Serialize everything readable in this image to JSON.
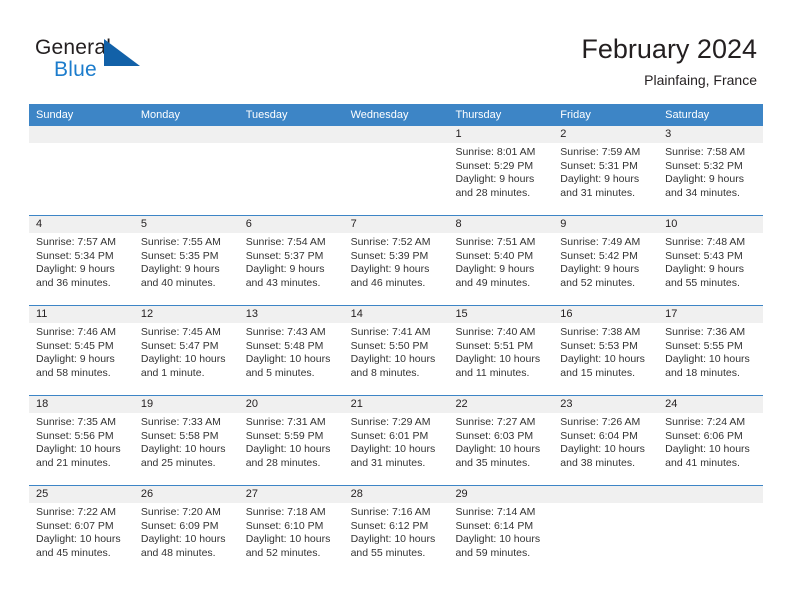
{
  "brand": {
    "name_part1": "General",
    "name_part2": "Blue",
    "logo_icon": "blue-triangle-logo",
    "color_blue": "#1c7ccc",
    "color_dark": "#231f20"
  },
  "header": {
    "title": "February 2024",
    "location": "Plainfaing, France"
  },
  "theme": {
    "header_row_bg": "#3d85c6",
    "date_band_bg": "#f0f0f0",
    "cell_bg": "#ffffff",
    "text": "#231f20"
  },
  "weekdays": [
    "Sunday",
    "Monday",
    "Tuesday",
    "Wednesday",
    "Thursday",
    "Friday",
    "Saturday"
  ],
  "weeks": [
    {
      "dates": [
        "",
        "",
        "",
        "",
        "1",
        "2",
        "3"
      ],
      "cells": [
        {
          "lines": []
        },
        {
          "lines": []
        },
        {
          "lines": []
        },
        {
          "lines": []
        },
        {
          "lines": [
            "Sunrise: 8:01 AM",
            "Sunset: 5:29 PM",
            "Daylight: 9 hours",
            "and 28 minutes."
          ]
        },
        {
          "lines": [
            "Sunrise: 7:59 AM",
            "Sunset: 5:31 PM",
            "Daylight: 9 hours",
            "and 31 minutes."
          ]
        },
        {
          "lines": [
            "Sunrise: 7:58 AM",
            "Sunset: 5:32 PM",
            "Daylight: 9 hours",
            "and 34 minutes."
          ]
        }
      ]
    },
    {
      "dates": [
        "4",
        "5",
        "6",
        "7",
        "8",
        "9",
        "10"
      ],
      "cells": [
        {
          "lines": [
            "Sunrise: 7:57 AM",
            "Sunset: 5:34 PM",
            "Daylight: 9 hours",
            "and 36 minutes."
          ]
        },
        {
          "lines": [
            "Sunrise: 7:55 AM",
            "Sunset: 5:35 PM",
            "Daylight: 9 hours",
            "and 40 minutes."
          ]
        },
        {
          "lines": [
            "Sunrise: 7:54 AM",
            "Sunset: 5:37 PM",
            "Daylight: 9 hours",
            "and 43 minutes."
          ]
        },
        {
          "lines": [
            "Sunrise: 7:52 AM",
            "Sunset: 5:39 PM",
            "Daylight: 9 hours",
            "and 46 minutes."
          ]
        },
        {
          "lines": [
            "Sunrise: 7:51 AM",
            "Sunset: 5:40 PM",
            "Daylight: 9 hours",
            "and 49 minutes."
          ]
        },
        {
          "lines": [
            "Sunrise: 7:49 AM",
            "Sunset: 5:42 PM",
            "Daylight: 9 hours",
            "and 52 minutes."
          ]
        },
        {
          "lines": [
            "Sunrise: 7:48 AM",
            "Sunset: 5:43 PM",
            "Daylight: 9 hours",
            "and 55 minutes."
          ]
        }
      ]
    },
    {
      "dates": [
        "11",
        "12",
        "13",
        "14",
        "15",
        "16",
        "17"
      ],
      "cells": [
        {
          "lines": [
            "Sunrise: 7:46 AM",
            "Sunset: 5:45 PM",
            "Daylight: 9 hours",
            "and 58 minutes."
          ]
        },
        {
          "lines": [
            "Sunrise: 7:45 AM",
            "Sunset: 5:47 PM",
            "Daylight: 10 hours",
            "and 1 minute."
          ]
        },
        {
          "lines": [
            "Sunrise: 7:43 AM",
            "Sunset: 5:48 PM",
            "Daylight: 10 hours",
            "and 5 minutes."
          ]
        },
        {
          "lines": [
            "Sunrise: 7:41 AM",
            "Sunset: 5:50 PM",
            "Daylight: 10 hours",
            "and 8 minutes."
          ]
        },
        {
          "lines": [
            "Sunrise: 7:40 AM",
            "Sunset: 5:51 PM",
            "Daylight: 10 hours",
            "and 11 minutes."
          ]
        },
        {
          "lines": [
            "Sunrise: 7:38 AM",
            "Sunset: 5:53 PM",
            "Daylight: 10 hours",
            "and 15 minutes."
          ]
        },
        {
          "lines": [
            "Sunrise: 7:36 AM",
            "Sunset: 5:55 PM",
            "Daylight: 10 hours",
            "and 18 minutes."
          ]
        }
      ]
    },
    {
      "dates": [
        "18",
        "19",
        "20",
        "21",
        "22",
        "23",
        "24"
      ],
      "cells": [
        {
          "lines": [
            "Sunrise: 7:35 AM",
            "Sunset: 5:56 PM",
            "Daylight: 10 hours",
            "and 21 minutes."
          ]
        },
        {
          "lines": [
            "Sunrise: 7:33 AM",
            "Sunset: 5:58 PM",
            "Daylight: 10 hours",
            "and 25 minutes."
          ]
        },
        {
          "lines": [
            "Sunrise: 7:31 AM",
            "Sunset: 5:59 PM",
            "Daylight: 10 hours",
            "and 28 minutes."
          ]
        },
        {
          "lines": [
            "Sunrise: 7:29 AM",
            "Sunset: 6:01 PM",
            "Daylight: 10 hours",
            "and 31 minutes."
          ]
        },
        {
          "lines": [
            "Sunrise: 7:27 AM",
            "Sunset: 6:03 PM",
            "Daylight: 10 hours",
            "and 35 minutes."
          ]
        },
        {
          "lines": [
            "Sunrise: 7:26 AM",
            "Sunset: 6:04 PM",
            "Daylight: 10 hours",
            "and 38 minutes."
          ]
        },
        {
          "lines": [
            "Sunrise: 7:24 AM",
            "Sunset: 6:06 PM",
            "Daylight: 10 hours",
            "and 41 minutes."
          ]
        }
      ]
    },
    {
      "dates": [
        "25",
        "26",
        "27",
        "28",
        "29",
        "",
        ""
      ],
      "cells": [
        {
          "lines": [
            "Sunrise: 7:22 AM",
            "Sunset: 6:07 PM",
            "Daylight: 10 hours",
            "and 45 minutes."
          ]
        },
        {
          "lines": [
            "Sunrise: 7:20 AM",
            "Sunset: 6:09 PM",
            "Daylight: 10 hours",
            "and 48 minutes."
          ]
        },
        {
          "lines": [
            "Sunrise: 7:18 AM",
            "Sunset: 6:10 PM",
            "Daylight: 10 hours",
            "and 52 minutes."
          ]
        },
        {
          "lines": [
            "Sunrise: 7:16 AM",
            "Sunset: 6:12 PM",
            "Daylight: 10 hours",
            "and 55 minutes."
          ]
        },
        {
          "lines": [
            "Sunrise: 7:14 AM",
            "Sunset: 6:14 PM",
            "Daylight: 10 hours",
            "and 59 minutes."
          ]
        },
        {
          "lines": []
        },
        {
          "lines": []
        }
      ]
    }
  ]
}
